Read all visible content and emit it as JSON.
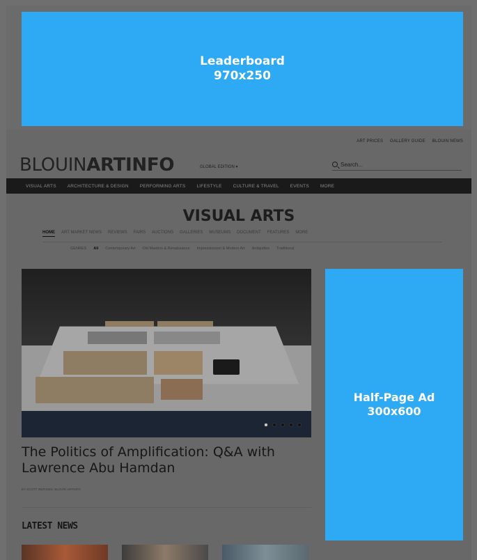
{
  "ads": {
    "leaderboard_line1": "Leaderboard",
    "leaderboard_line2": "970x250",
    "halfpage_line1": "Half-Page Ad",
    "halfpage_line2": "300x600",
    "ad_color": "#2eaaf5"
  },
  "header": {
    "toplinks": [
      "ART PRICES",
      "GALLERY GUIDE",
      "BLOUIN NEWS"
    ],
    "logo_light": "BLOUIN",
    "logo_bold": "ARTINFO",
    "edition": "GLOBAL EDITION",
    "search_placeholder": "Search..."
  },
  "mainnav": [
    "VISUAL ARTS",
    "ARCHITECTURE & DESIGN",
    "PERFORMING ARTS",
    "LIFESTYLE",
    "CULTURE & TRAVEL",
    "EVENTS",
    "MORE"
  ],
  "section": {
    "title": "VISUAL ARTS",
    "subnav": [
      "HOME",
      "ART MARKET NEWS",
      "REVIEWS",
      "FAIRS",
      "AUCTIONS",
      "GALLERIES",
      "MUSEUMS",
      "DOCUMENT",
      "FEATURES",
      "MORE"
    ],
    "subnav_active_index": 0,
    "filters": [
      "GENRES",
      "All",
      "Contemporary Art",
      "Old Masters & Renaissance",
      "Impressionism & Modern Art",
      "Antiquities",
      "Traditional"
    ],
    "filters_active_index": 1
  },
  "feature": {
    "headline": "The Politics of Amplification: Q&A with Lawrence Abu Hamdan",
    "byline": "BY SCOTT INDRISEK, BLOUIN ARTINFO",
    "slide_count": 5,
    "active_slide": 0
  },
  "latest": {
    "heading": "LATEST NEWS"
  }
}
